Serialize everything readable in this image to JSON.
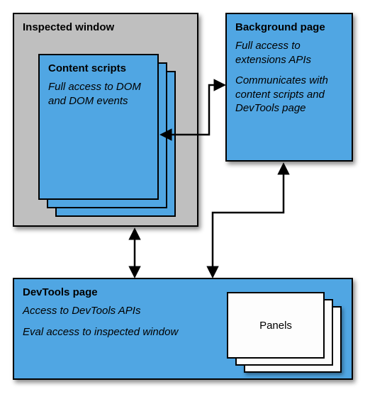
{
  "inspected_window": {
    "title": "Inspected window"
  },
  "content_scripts": {
    "title": "Content scripts",
    "desc": "Full access to DOM and DOM events"
  },
  "background_page": {
    "title": "Background page",
    "desc1": "Full access to extensions APIs",
    "desc2": "Communicates with content scripts and DevTools page"
  },
  "devtools_page": {
    "title": "DevTools page",
    "desc1": "Access to DevTools APIs",
    "desc2": "Eval access to inspected window",
    "panels_label": "Panels"
  }
}
